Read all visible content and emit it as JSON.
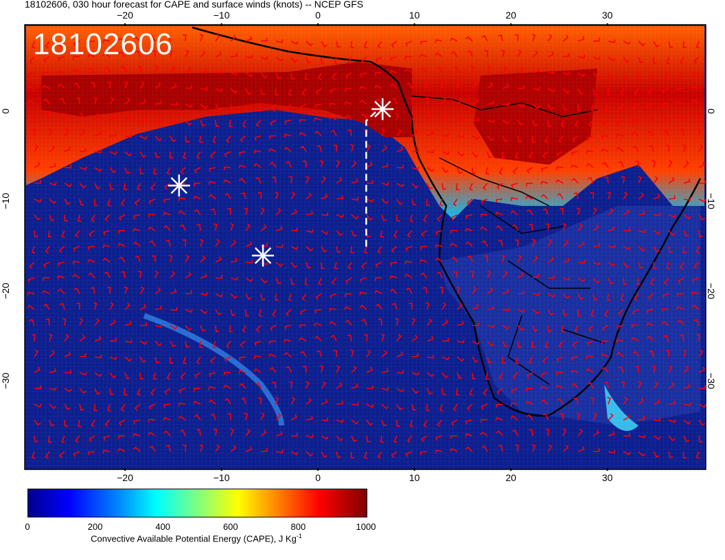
{
  "title": "18102606, 030 hour forecast for CAPE and surface winds (knots) -- NCEP GFS",
  "date_stamp": "18102606",
  "x_ticks": [
    "−20",
    "−10",
    "0",
    "10",
    "20",
    "30"
  ],
  "x_tick_values": [
    -20,
    -10,
    0,
    10,
    20,
    30
  ],
  "y_ticks": [
    "0",
    "−10",
    "−20",
    "−30"
  ],
  "y_tick_values": [
    0,
    -10,
    -20,
    -30
  ],
  "lon_range": [
    -30.4,
    40.2
  ],
  "lat_range": [
    -39.8,
    9.7
  ],
  "colorbar": {
    "label_main": "Convective Available Potential Energy (CAPE), J Kg",
    "label_sup": "-1",
    "ticks": [
      "0",
      "200",
      "400",
      "600",
      "800",
      "1000"
    ],
    "tick_values": [
      0,
      200,
      400,
      600,
      800,
      1000
    ],
    "range": [
      0,
      1000
    ]
  },
  "markers": [
    {
      "name": "site-asterisk-1",
      "lon": 6.7,
      "lat": 0.3
    },
    {
      "name": "site-asterisk-2",
      "lon": -14.4,
      "lat": -8.2
    },
    {
      "name": "site-asterisk-3",
      "lon": -5.7,
      "lat": -16.0
    }
  ],
  "flight_track": [
    {
      "lon": 5.0,
      "lat": -15.0
    },
    {
      "lon": 5.0,
      "lat": -1.0
    },
    {
      "lon": 6.0,
      "lat": 0.0
    }
  ],
  "colors": {
    "ocean_low": "#10208f",
    "wind_barb": "#ff0000",
    "coast": "#000000",
    "high_cape": "#a00000"
  }
}
